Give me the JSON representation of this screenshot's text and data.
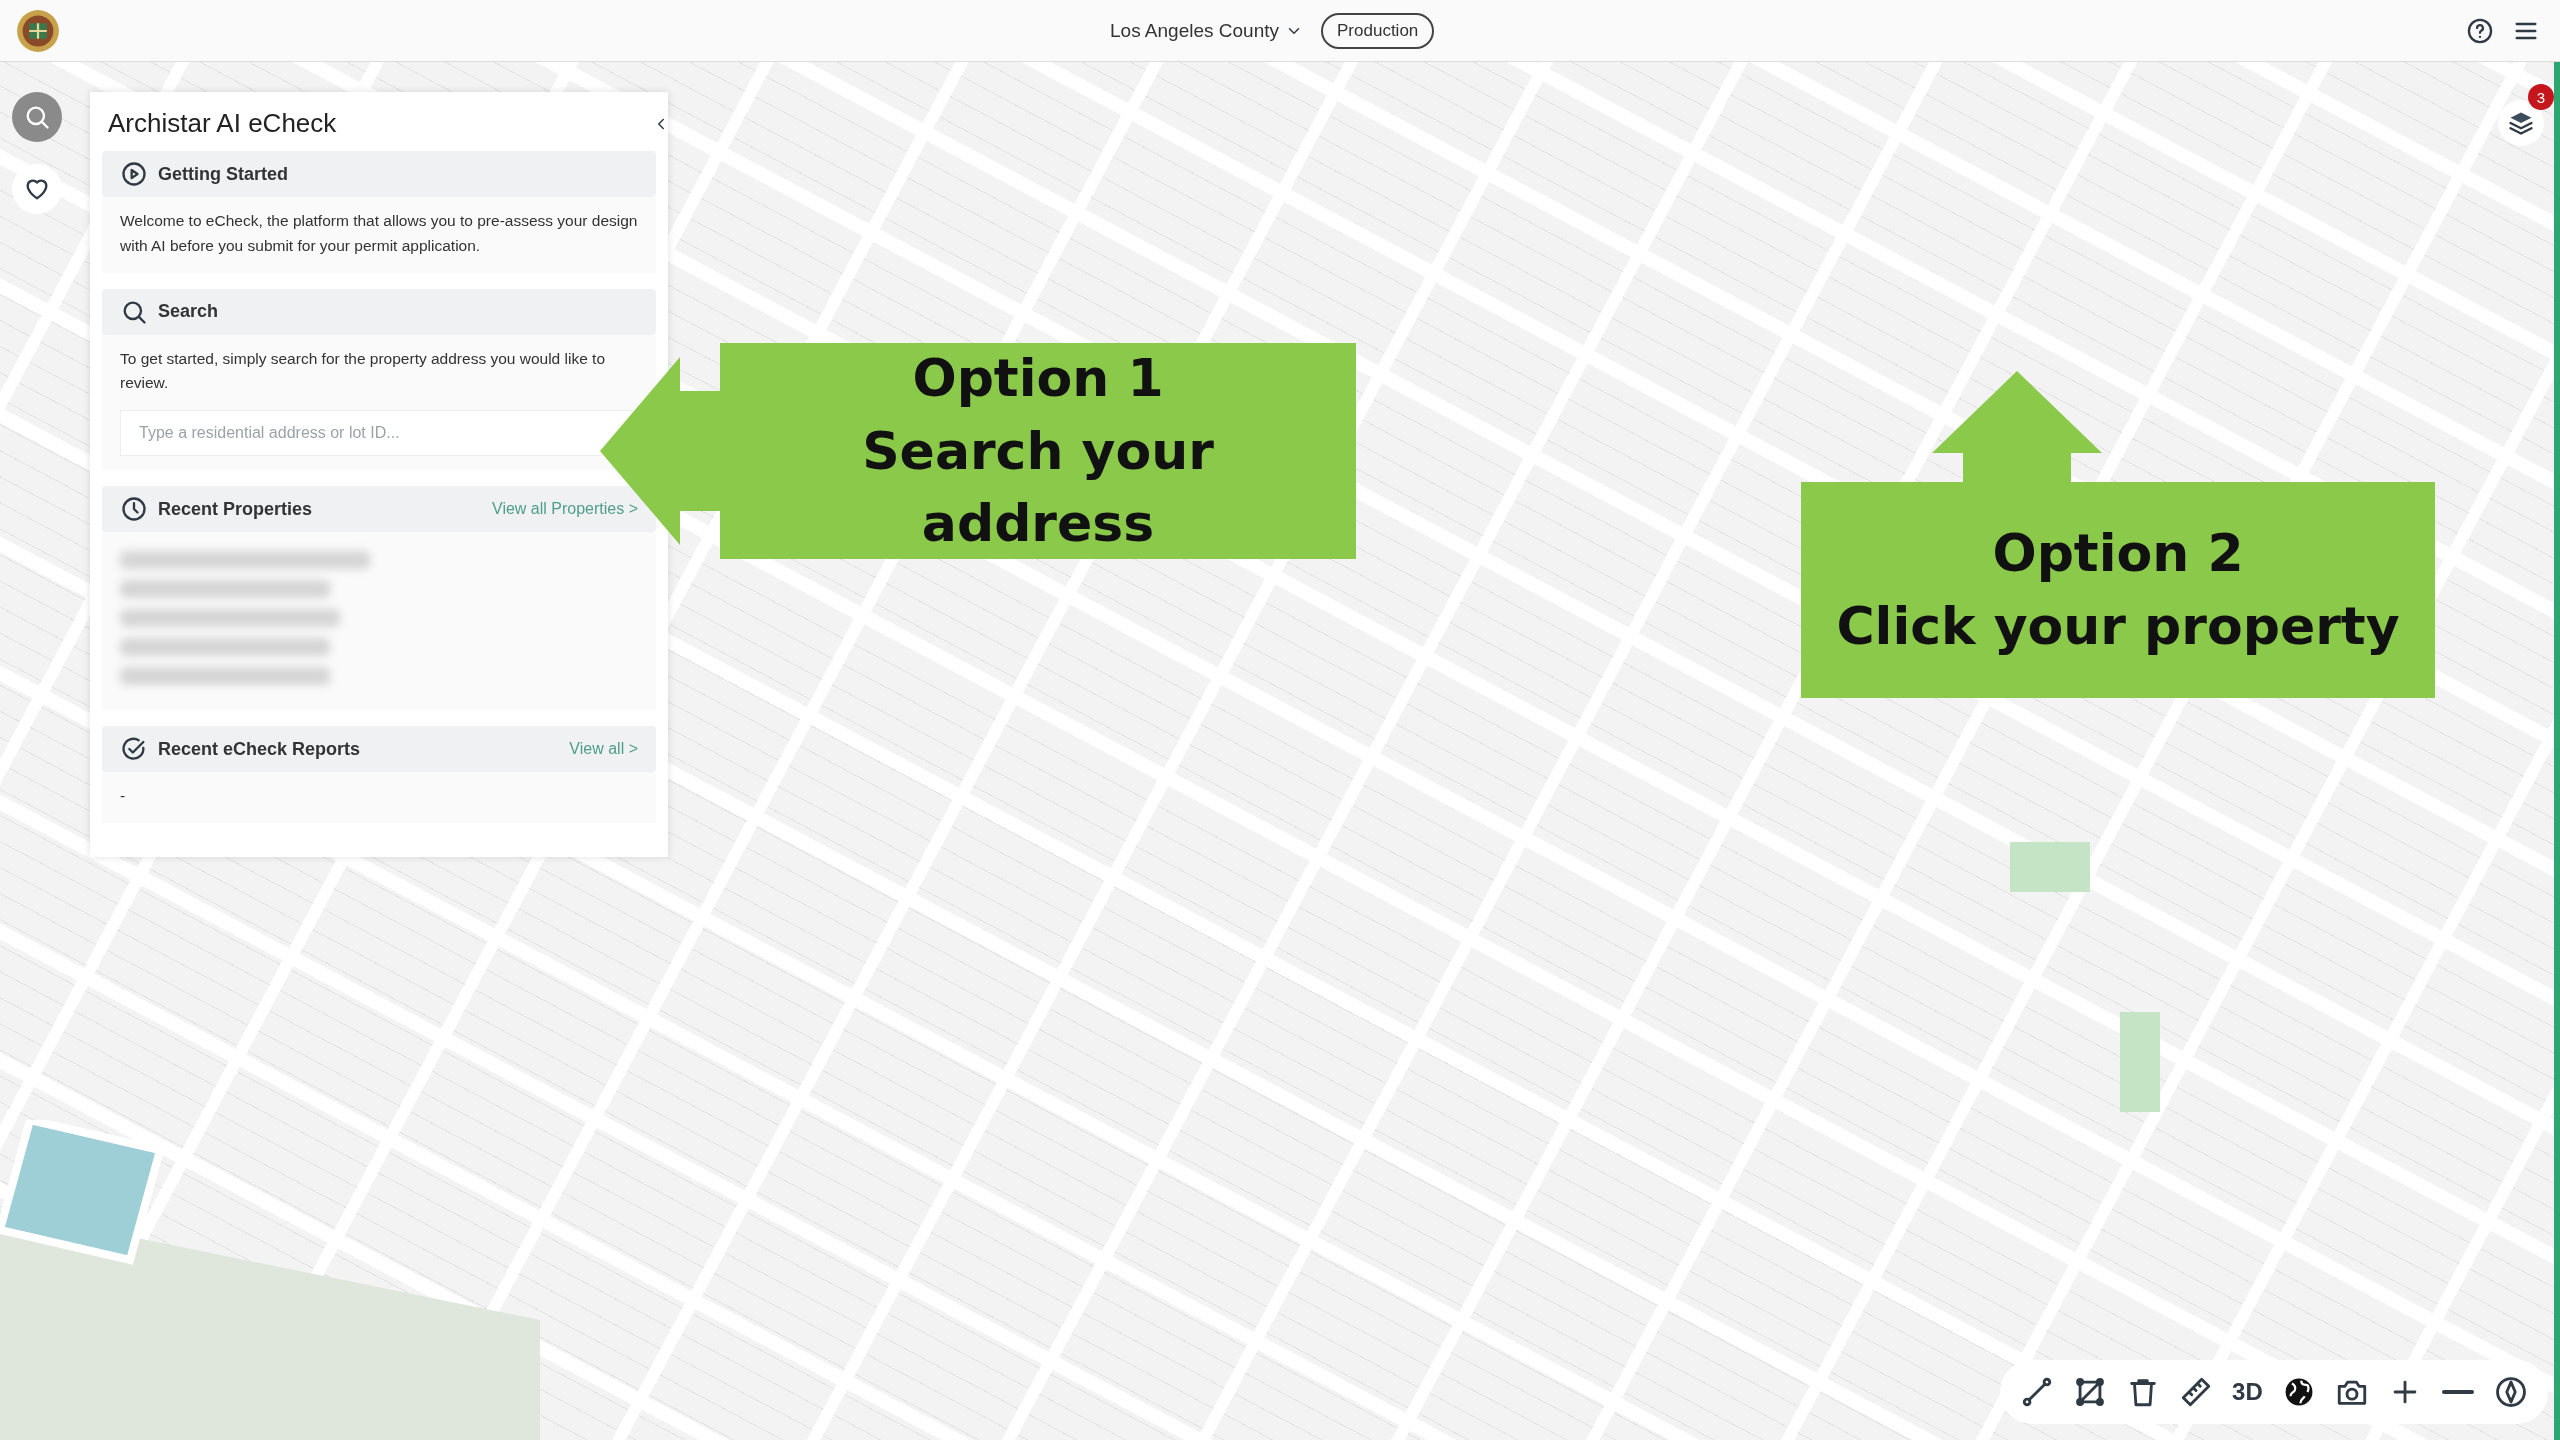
{
  "header": {
    "region": "Los Angeles County",
    "environment": "Production"
  },
  "side_buttons": [
    {
      "kind": "search"
    },
    {
      "kind": "favorite"
    }
  ],
  "panel": {
    "title": "Archistar AI eCheck",
    "sections": [
      {
        "kind": "info",
        "title": "Getting Started",
        "text": "Welcome to eCheck, the platform that allows you to pre-assess your design with AI before you submit for your permit application."
      },
      {
        "kind": "search",
        "title": "Search",
        "text": "To get started, simply search for the property address you would like to review.",
        "placeholder": "Type a residential address or lot ID..."
      },
      {
        "kind": "list",
        "title": "Recent Properties",
        "link": "View all Properties >"
      },
      {
        "kind": "empty",
        "title": "Recent eCheck Reports",
        "link": "View all >",
        "text": "-"
      }
    ]
  },
  "callouts": [
    {
      "kind": "left",
      "lines": [
        "Option 1",
        "Search your",
        "address"
      ]
    },
    {
      "kind": "up",
      "lines": [
        "Option 2",
        "Click your property"
      ]
    }
  ],
  "layers": {
    "badge": "3"
  },
  "toolbar": [
    {
      "kind": "line"
    },
    {
      "kind": "polygon"
    },
    {
      "kind": "trash"
    },
    {
      "kind": "ruler"
    },
    {
      "kind": "text",
      "label": "3D"
    },
    {
      "kind": "globe"
    },
    {
      "kind": "camera"
    },
    {
      "kind": "plus"
    },
    {
      "kind": "minus"
    },
    {
      "kind": "compass"
    }
  ]
}
